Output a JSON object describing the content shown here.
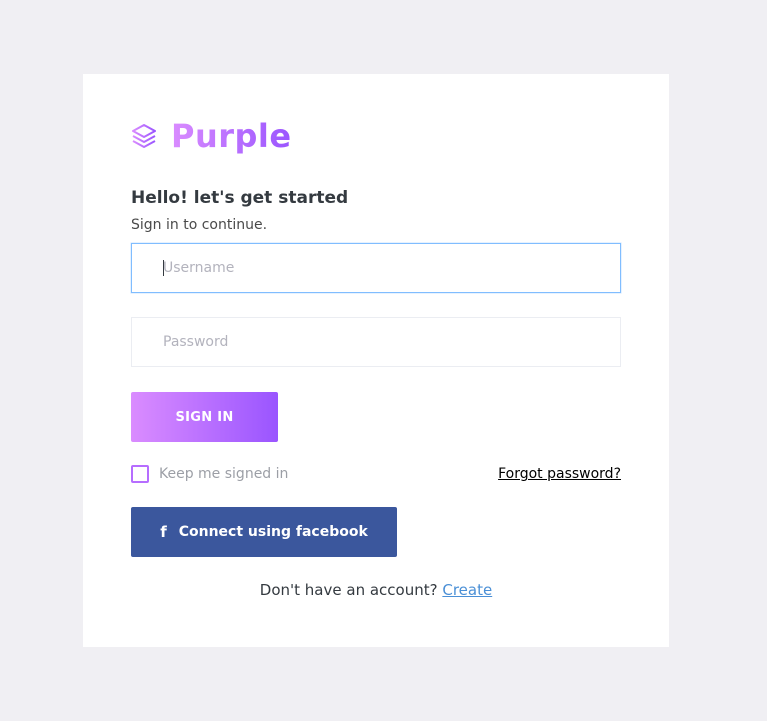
{
  "brand": {
    "name": "Purple",
    "icon": "layers-icon",
    "color_start": "#da8cff",
    "color_end": "#9a55ff"
  },
  "heading": "Hello! let's get started",
  "subheading": "Sign in to continue.",
  "username": {
    "placeholder": "Username",
    "value": ""
  },
  "password": {
    "placeholder": "Password",
    "value": ""
  },
  "signin_button": "SIGN IN",
  "remember": {
    "label": "Keep me signed in",
    "checked": false
  },
  "forgot_password": "Forgot password?",
  "facebook_button": {
    "icon": "facebook-icon",
    "label": "Connect using facebook",
    "color": "#3b579d"
  },
  "signup": {
    "prompt": "Don't have an account?",
    "link": "Create"
  }
}
